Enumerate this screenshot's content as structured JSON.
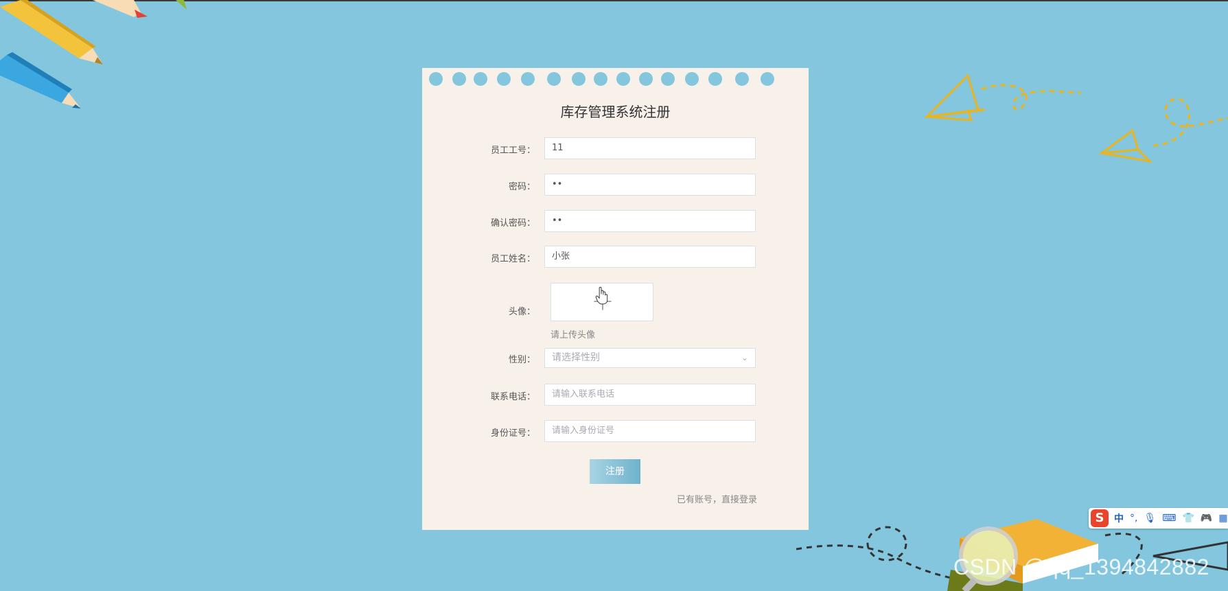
{
  "title": "库存管理系统注册",
  "form": {
    "employee_id": {
      "label": "员工工号：",
      "value": "11"
    },
    "password": {
      "label": "密码：",
      "value": "••"
    },
    "confirm_password": {
      "label": "确认密码：",
      "value": "••"
    },
    "employee_name": {
      "label": "员工姓名：",
      "value": "小张"
    },
    "avatar": {
      "label": "头像：",
      "hint": "请上传头像"
    },
    "gender": {
      "label": "性别：",
      "placeholder": "请选择性别"
    },
    "phone": {
      "label": "联系电话：",
      "placeholder": "请输入联系电话"
    },
    "id_card": {
      "label": "身份证号：",
      "placeholder": "请输入身份证号"
    },
    "submit_label": "注册",
    "login_link": "已有账号，直接登录"
  },
  "ime": {
    "logo": "S",
    "mode": "中",
    "icons": [
      "punctuation-icon",
      "microphone-icon",
      "keyboard-icon",
      "skin-icon",
      "game-icon",
      "toolbox-icon"
    ]
  },
  "watermark": "CSDN @qq_1394842882",
  "colors": {
    "background": "#84c6de",
    "card": "#f8f1ea",
    "button_start": "#a8d4e4",
    "button_end": "#6fb2cc"
  }
}
